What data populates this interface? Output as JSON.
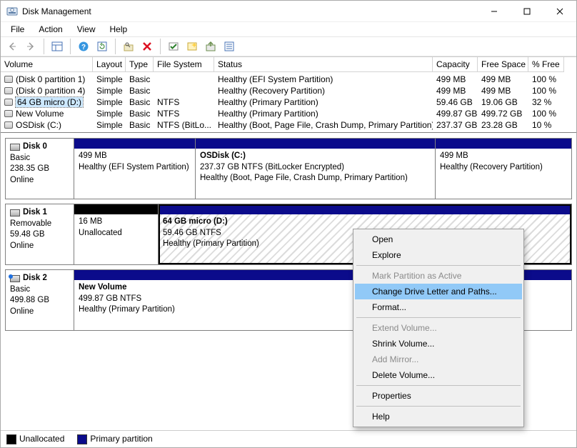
{
  "window": {
    "title": "Disk Management"
  },
  "menu": {
    "file": "File",
    "action": "Action",
    "view": "View",
    "help": "Help"
  },
  "table": {
    "headers": {
      "volume": "Volume",
      "layout": "Layout",
      "type": "Type",
      "fs": "File System",
      "status": "Status",
      "capacity": "Capacity",
      "free": "Free Space",
      "pct": "% Free"
    },
    "rows": [
      {
        "volume": "(Disk 0 partition 1)",
        "layout": "Simple",
        "type": "Basic",
        "fs": "",
        "status": "Healthy (EFI System Partition)",
        "capacity": "499 MB",
        "free": "499 MB",
        "pct": "100 %"
      },
      {
        "volume": "(Disk 0 partition 4)",
        "layout": "Simple",
        "type": "Basic",
        "fs": "",
        "status": "Healthy (Recovery Partition)",
        "capacity": "499 MB",
        "free": "499 MB",
        "pct": "100 %"
      },
      {
        "volume": "64 GB micro (D:)",
        "layout": "Simple",
        "type": "Basic",
        "fs": "NTFS",
        "status": "Healthy (Primary Partition)",
        "capacity": "59.46 GB",
        "free": "19.06 GB",
        "pct": "32 %"
      },
      {
        "volume": "New Volume",
        "layout": "Simple",
        "type": "Basic",
        "fs": "NTFS",
        "status": "Healthy (Primary Partition)",
        "capacity": "499.87 GB",
        "free": "499.72 GB",
        "pct": "100 %"
      },
      {
        "volume": "OSDisk (C:)",
        "layout": "Simple",
        "type": "Basic",
        "fs": "NTFS (BitLo...",
        "status": "Healthy (Boot, Page File, Crash Dump, Primary Partition)",
        "capacity": "237.37 GB",
        "free": "23.28 GB",
        "pct": "10 %"
      }
    ],
    "selected_index": 2
  },
  "disks": {
    "d0": {
      "name": "Disk 0",
      "type": "Basic",
      "capacity": "238.35 GB",
      "state": "Online",
      "p0": {
        "name": "",
        "size": "499 MB",
        "status": "Healthy (EFI System Partition)"
      },
      "p1": {
        "name": "OSDisk (C:)",
        "size": "237.37 GB NTFS (BitLocker Encrypted)",
        "status": "Healthy (Boot, Page File, Crash Dump, Primary Partition)"
      },
      "p2": {
        "name": "",
        "size": "499 MB",
        "status": "Healthy (Recovery Partition)"
      }
    },
    "d1": {
      "name": "Disk 1",
      "type": "Removable",
      "capacity": "59.48 GB",
      "state": "Online",
      "p0": {
        "name": "",
        "size": "16 MB",
        "status": "Unallocated"
      },
      "p1": {
        "name": "64 GB micro  (D:)",
        "size": "59.46 GB NTFS",
        "status": "Healthy (Primary Partition)"
      }
    },
    "d2": {
      "name": "Disk 2",
      "type": "Basic",
      "capacity": "499.88 GB",
      "state": "Online",
      "p0": {
        "name": "New Volume",
        "size": "499.87 GB NTFS",
        "status": "Healthy (Primary Partition)"
      }
    }
  },
  "legend": {
    "unalloc": "Unallocated",
    "primary": "Primary partition"
  },
  "ctx": {
    "open": "Open",
    "explore": "Explore",
    "markactive": "Mark Partition as Active",
    "changeletter": "Change Drive Letter and Paths...",
    "format": "Format...",
    "extend": "Extend Volume...",
    "shrink": "Shrink Volume...",
    "addmirror": "Add Mirror...",
    "delete": "Delete Volume...",
    "properties": "Properties",
    "help": "Help"
  }
}
